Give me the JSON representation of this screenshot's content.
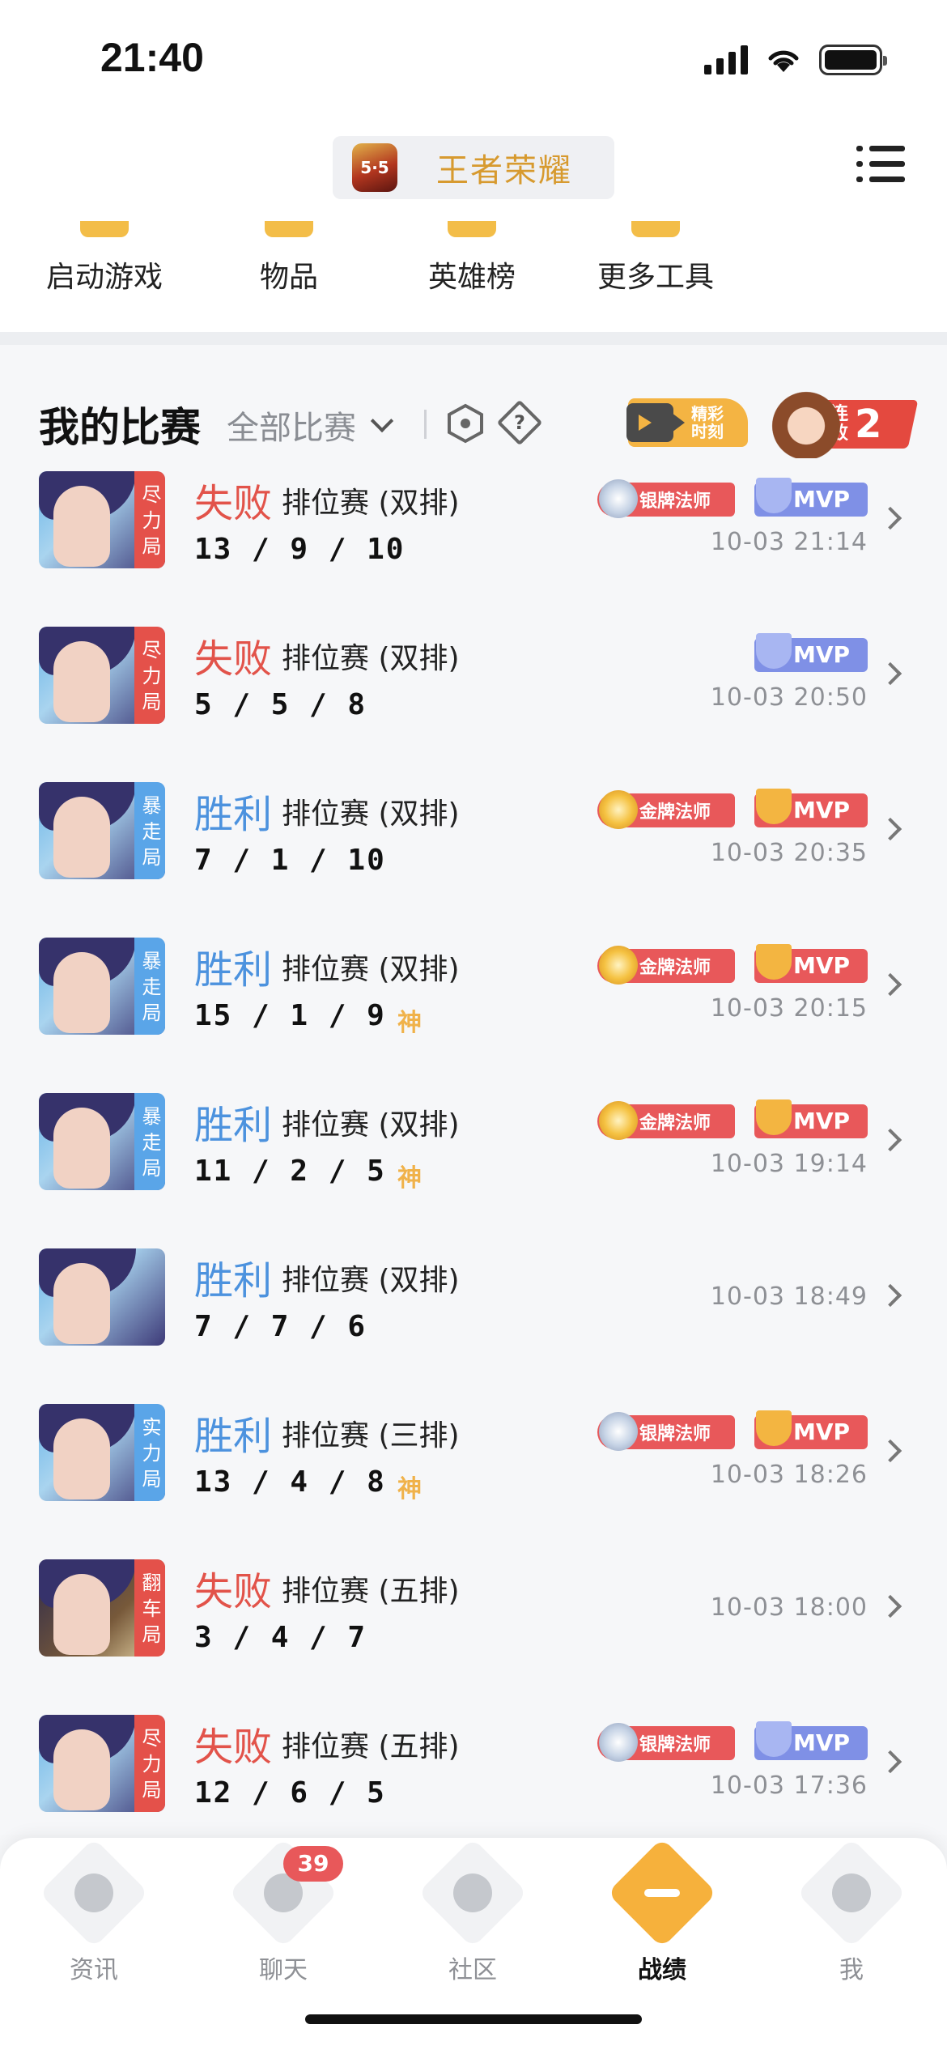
{
  "status": {
    "time": "21:40"
  },
  "header": {
    "game_name": "王者荣耀",
    "logo_text": "5·5"
  },
  "tools": [
    {
      "label": "启动游戏"
    },
    {
      "label": "物品"
    },
    {
      "label": "英雄榜"
    },
    {
      "label": "更多工具"
    }
  ],
  "section": {
    "title": "我的比赛",
    "filter": "全部比赛",
    "help_glyph": "?",
    "highlight_label_1": "精彩",
    "highlight_label_2": "时刻",
    "streak_label_1": "连",
    "streak_label_2": "败",
    "streak_count": "2"
  },
  "matches": [
    {
      "result": "失败",
      "outcome": "lose",
      "mode": "排位赛 (双排)",
      "kda": "13 / 9 / 10",
      "god": "",
      "tag": "尽力局",
      "tag_color": "red",
      "badge": "银牌法师",
      "badge_type": "silver",
      "mvp": "MVP",
      "mvp_type": "silver",
      "time": "10-03 21:14"
    },
    {
      "result": "失败",
      "outcome": "lose",
      "mode": "排位赛 (双排)",
      "kda": "5 / 5 / 8",
      "god": "",
      "tag": "尽力局",
      "tag_color": "red",
      "badge": "",
      "badge_type": "",
      "mvp": "MVP",
      "mvp_type": "silver",
      "time": "10-03 20:50"
    },
    {
      "result": "胜利",
      "outcome": "win",
      "mode": "排位赛 (双排)",
      "kda": "7 / 1 / 10",
      "god": "",
      "tag": "暴走局",
      "tag_color": "blue",
      "badge": "金牌法师",
      "badge_type": "gold",
      "mvp": "MVP",
      "mvp_type": "gold",
      "time": "10-03 20:35"
    },
    {
      "result": "胜利",
      "outcome": "win",
      "mode": "排位赛 (双排)",
      "kda": "15 / 1 / 9",
      "god": "神",
      "tag": "暴走局",
      "tag_color": "blue",
      "badge": "金牌法师",
      "badge_type": "gold",
      "mvp": "MVP",
      "mvp_type": "gold",
      "time": "10-03 20:15"
    },
    {
      "result": "胜利",
      "outcome": "win",
      "mode": "排位赛 (双排)",
      "kda": "11 / 2 / 5",
      "god": "神",
      "tag": "暴走局",
      "tag_color": "blue",
      "badge": "金牌法师",
      "badge_type": "gold",
      "mvp": "MVP",
      "mvp_type": "gold",
      "time": "10-03 19:14"
    },
    {
      "result": "胜利",
      "outcome": "win",
      "mode": "排位赛 (双排)",
      "kda": "7 / 7 / 6",
      "god": "",
      "tag": "",
      "tag_color": "",
      "badge": "",
      "badge_type": "",
      "mvp": "",
      "mvp_type": "",
      "time": "10-03 18:49"
    },
    {
      "result": "胜利",
      "outcome": "win",
      "mode": "排位赛 (三排)",
      "kda": "13 / 4 / 8",
      "god": "神",
      "tag": "实力局",
      "tag_color": "blue",
      "badge": "银牌法师",
      "badge_type": "silver",
      "mvp": "MVP",
      "mvp_type": "gold",
      "time": "10-03 18:26"
    },
    {
      "result": "失败",
      "outcome": "lose",
      "mode": "排位赛 (五排)",
      "kda": "3 / 4 / 7",
      "god": "",
      "tag": "翻车局",
      "tag_color": "red",
      "badge": "",
      "badge_type": "",
      "mvp": "",
      "mvp_type": "",
      "time": "10-03 18:00",
      "avatar_style": "dark"
    },
    {
      "result": "失败",
      "outcome": "lose",
      "mode": "排位赛 (五排)",
      "kda": "12 / 6 / 5",
      "god": "",
      "tag": "尽力局",
      "tag_color": "red",
      "badge": "银牌法师",
      "badge_type": "silver",
      "mvp": "MVP",
      "mvp_type": "silver",
      "time": "10-03 17:36"
    }
  ],
  "tabs": [
    {
      "label": "资讯",
      "icon": "news-icon"
    },
    {
      "label": "聊天",
      "icon": "chat-icon",
      "unread": "39"
    },
    {
      "label": "社区",
      "icon": "community-icon"
    },
    {
      "label": "战绩",
      "icon": "battle-record-icon",
      "active": true
    },
    {
      "label": "我",
      "icon": "profile-icon"
    }
  ],
  "colors": {
    "lose": "#e2534a",
    "win": "#4c92de",
    "accent": "#f6b13c",
    "game_name": "#d79a2f"
  }
}
